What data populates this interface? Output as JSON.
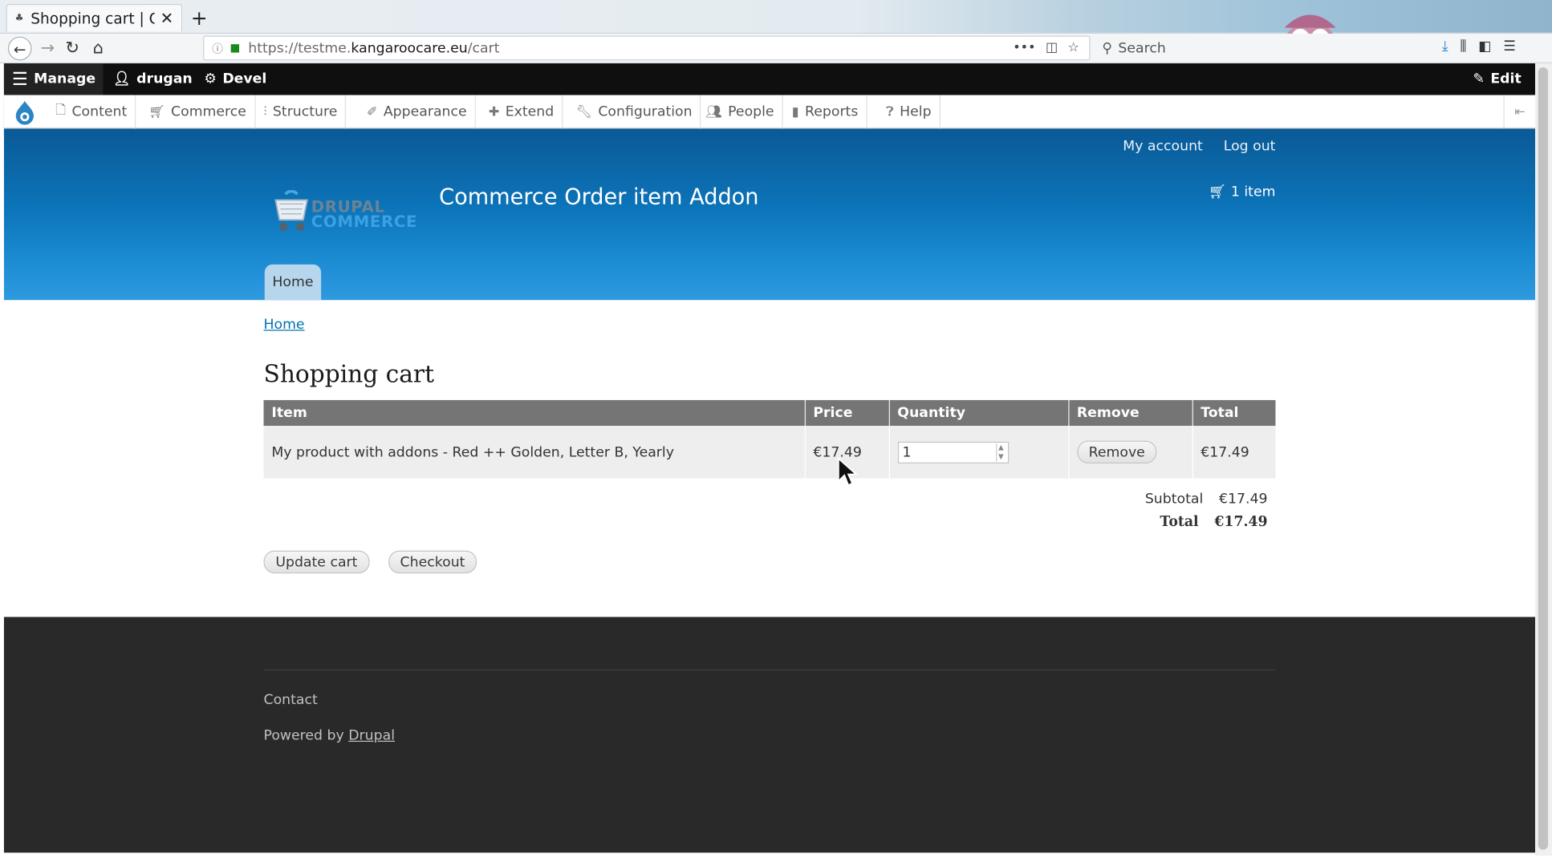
{
  "browser": {
    "tab_title": "Shopping cart | Com",
    "new_tab": "+",
    "url_prefix": "https://testme.",
    "url_domain": "kangaroocare.eu",
    "url_path": "/cart",
    "search_placeholder": "Search"
  },
  "toolbar": {
    "manage": "Manage",
    "user": "drugan",
    "devel": "Devel",
    "edit": "Edit"
  },
  "admin_menu": [
    {
      "label": "Content",
      "icon": "page-icon"
    },
    {
      "label": "Commerce",
      "icon": "cart-icon"
    },
    {
      "label": "Structure",
      "icon": "structure-icon"
    },
    {
      "label": "Appearance",
      "icon": "brush-icon"
    },
    {
      "label": "Extend",
      "icon": "puzzle-icon"
    },
    {
      "label": "Configuration",
      "icon": "wrench-icon"
    },
    {
      "label": "People",
      "icon": "people-icon"
    },
    {
      "label": "Reports",
      "icon": "bar-chart-icon"
    },
    {
      "label": "Help",
      "icon": "help-icon"
    }
  ],
  "header": {
    "my_account": "My account",
    "log_out": "Log out",
    "logo_line1": "DRUPAL",
    "logo_line2": "COMMERCE",
    "site_name": "Commerce Order item Addon",
    "cart_count": "1 item",
    "home_tab": "Home"
  },
  "breadcrumb": "Home",
  "page_title": "Shopping cart",
  "cart": {
    "columns": [
      "Item",
      "Price",
      "Quantity",
      "Remove",
      "Total"
    ],
    "rows": [
      {
        "item": "My product with addons - Red ++ Golden, Letter B, Yearly",
        "price": "€17.49",
        "quantity": "1",
        "remove_label": "Remove",
        "total": "€17.49"
      }
    ],
    "subtotal_label": "Subtotal",
    "subtotal_value": "€17.49",
    "total_label": "Total",
    "total_value": "€17.49",
    "update_label": "Update cart",
    "checkout_label": "Checkout"
  },
  "footer": {
    "contact": "Contact",
    "powered_prefix": "Powered by",
    "powered_link": "Drupal"
  },
  "colors": {
    "header_blue": "#0c73b8",
    "link_blue": "#0071b3",
    "table_header": "#757575",
    "footer_bg": "#292929"
  }
}
